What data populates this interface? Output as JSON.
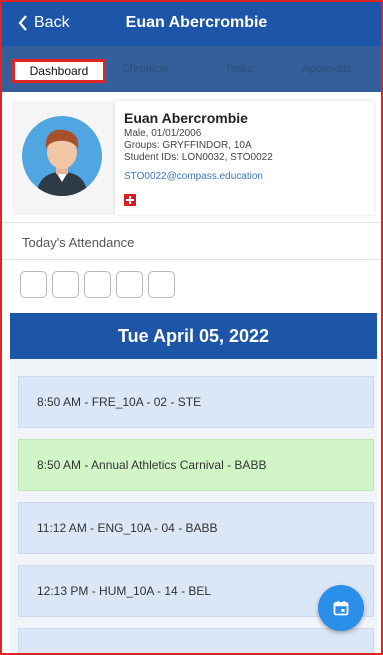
{
  "header": {
    "back_label": "Back",
    "title": "Euan Abercrombie"
  },
  "tabs": [
    {
      "label": "Dashboard",
      "active": true
    },
    {
      "label": "Chronicle",
      "active": false
    },
    {
      "label": "Tasks",
      "active": false
    },
    {
      "label": "Approvals",
      "active": false
    }
  ],
  "profile": {
    "name": "Euan Abercrombie",
    "gender_dob": "Male, 01/01/2006",
    "groups": "Groups: GRYFFINDOR, 10A",
    "student_ids": "Student IDs: LON0032, STO0022",
    "email": "STO0022@compass.education",
    "medical_icon": "medical-cross-icon"
  },
  "attendance": {
    "label": "Today's Attendance",
    "slots": 5
  },
  "date": "Tue April 05, 2022",
  "schedule": [
    {
      "text": "8:50 AM - FRE_10A - 02 - STE",
      "type": "class"
    },
    {
      "text": "8:50 AM - Annual Athletics Carnival - BABB",
      "type": "activity"
    },
    {
      "text": "11:12 AM - ENG_10A - 04 - BABB",
      "type": "class"
    },
    {
      "text": "12:13 PM - HUM_10A - 14 - BEL",
      "type": "class"
    }
  ],
  "colors": {
    "header": "#1d56a8",
    "tabs_bg": "#345f9a",
    "highlight": "#e02424",
    "class_entry": "#dbe6f6",
    "activity_entry": "#d2f5c8",
    "fab": "#2b8ee8"
  },
  "fab_icon": "calendar-icon"
}
